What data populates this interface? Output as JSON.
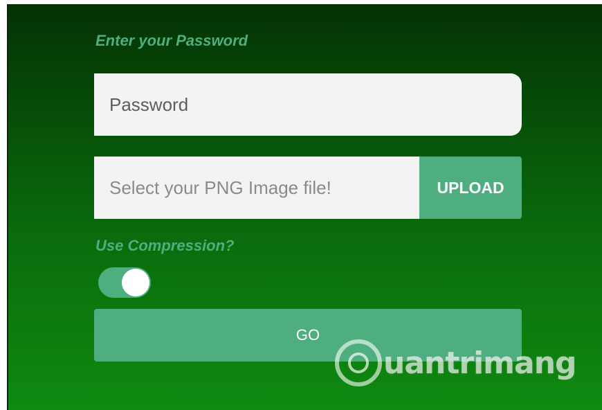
{
  "form": {
    "password_label": "Enter your Password",
    "password_placeholder": "Password",
    "file_placeholder": "Select your PNG Image file!",
    "upload_label": "UPLOAD",
    "compression_label": "Use Compression?",
    "compression_enabled": true,
    "go_label": "GO"
  },
  "watermark": {
    "text": "uantrimang",
    "icon": "lightbulb-icon"
  },
  "colors": {
    "accent": "#4fae80",
    "background_top": "#043204",
    "background_bottom": "#0f8a10",
    "field_bg": "#f3f3f3"
  }
}
